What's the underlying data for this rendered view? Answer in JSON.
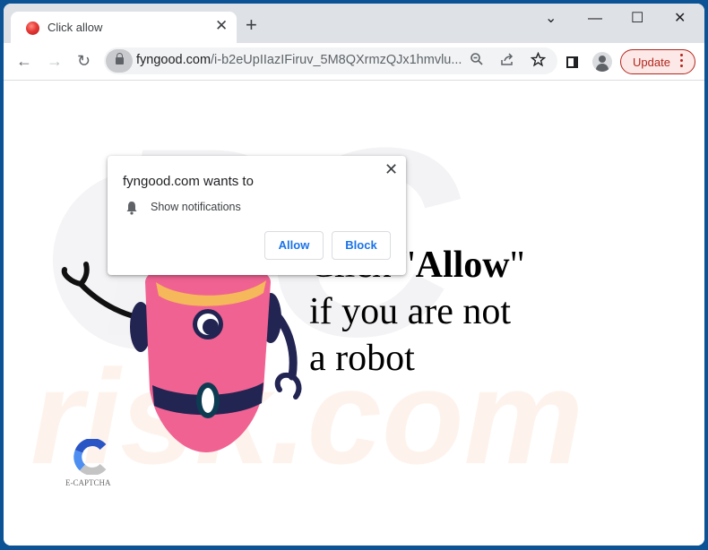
{
  "browser": {
    "tab": {
      "title": "Click allow",
      "close_glyph": "✕"
    },
    "new_tab_glyph": "+",
    "window_controls": {
      "tab_search": "⌄",
      "minimize": "—",
      "maximize": "☐",
      "close": "✕"
    },
    "nav": {
      "back": "←",
      "forward": "→",
      "reload": "↻"
    },
    "address": {
      "domain": "fyngood.com",
      "path": "/i-b2eUpIIazIFiruv_5M8QXrmzQJx1hmvlu..."
    },
    "omnibox_icons": {
      "zoom": "🔍︎",
      "share": "⇪",
      "bookmark": "☆"
    },
    "update_button": {
      "label": "Update"
    }
  },
  "permission_popup": {
    "title": "fyngood.com wants to",
    "permission": "Show notifications",
    "allow_label": "Allow",
    "block_label": "Block",
    "close_glyph": "✕"
  },
  "page": {
    "headline": {
      "line1_prefix": "Click \"",
      "line1_bold": "Allow",
      "line1_suffix": "\"",
      "line2": "if you are not",
      "line3": "a robot"
    },
    "captcha_label": "E-CAPTCHA",
    "watermark": {
      "top": "PC",
      "bottom": "risk.com"
    }
  },
  "colors": {
    "robot_pink": "#f06292",
    "robot_navy": "#222452",
    "robot_collar": "#f5b85a",
    "visor": "#0d3b52",
    "update_red": "#b3261e",
    "window_frame": "#0b5394"
  }
}
